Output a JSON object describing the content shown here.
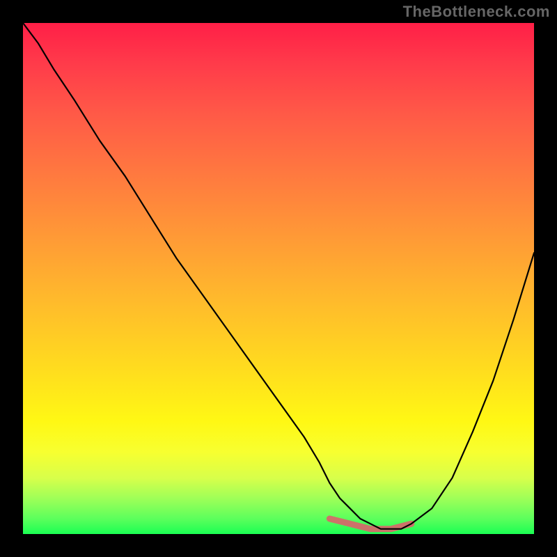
{
  "watermark": "TheBottleneck.com",
  "colors": {
    "frame_bg": "#000000",
    "curve": "#000000",
    "highlight": "#d46a6a",
    "gradient_top": "#ff1f47",
    "gradient_bottom": "#1aff53"
  },
  "chart_data": {
    "type": "line",
    "title": "",
    "xlabel": "",
    "ylabel": "",
    "xlim": [
      0,
      100
    ],
    "ylim": [
      0,
      100
    ],
    "grid": false,
    "legend": false,
    "notes": "No axis ticks or numeric labels are shown; x/y values are pixel-proportional estimates (0–100 normalized).",
    "series": [
      {
        "name": "bottleneck-curve",
        "x": [
          0,
          3,
          6,
          10,
          15,
          20,
          25,
          30,
          35,
          40,
          45,
          50,
          55,
          58,
          60,
          62,
          64,
          66,
          68,
          70,
          72,
          74,
          76,
          80,
          84,
          88,
          92,
          96,
          100
        ],
        "values": [
          100,
          96,
          91,
          85,
          77,
          70,
          62,
          54,
          47,
          40,
          33,
          26,
          19,
          14,
          10,
          7,
          5,
          3,
          2,
          1,
          1,
          1,
          2,
          5,
          11,
          20,
          30,
          42,
          55
        ]
      }
    ],
    "highlight_region": {
      "name": "optimal-range",
      "x": [
        60,
        64,
        68,
        72,
        76
      ],
      "values": [
        3,
        2,
        1,
        1,
        2
      ]
    }
  }
}
